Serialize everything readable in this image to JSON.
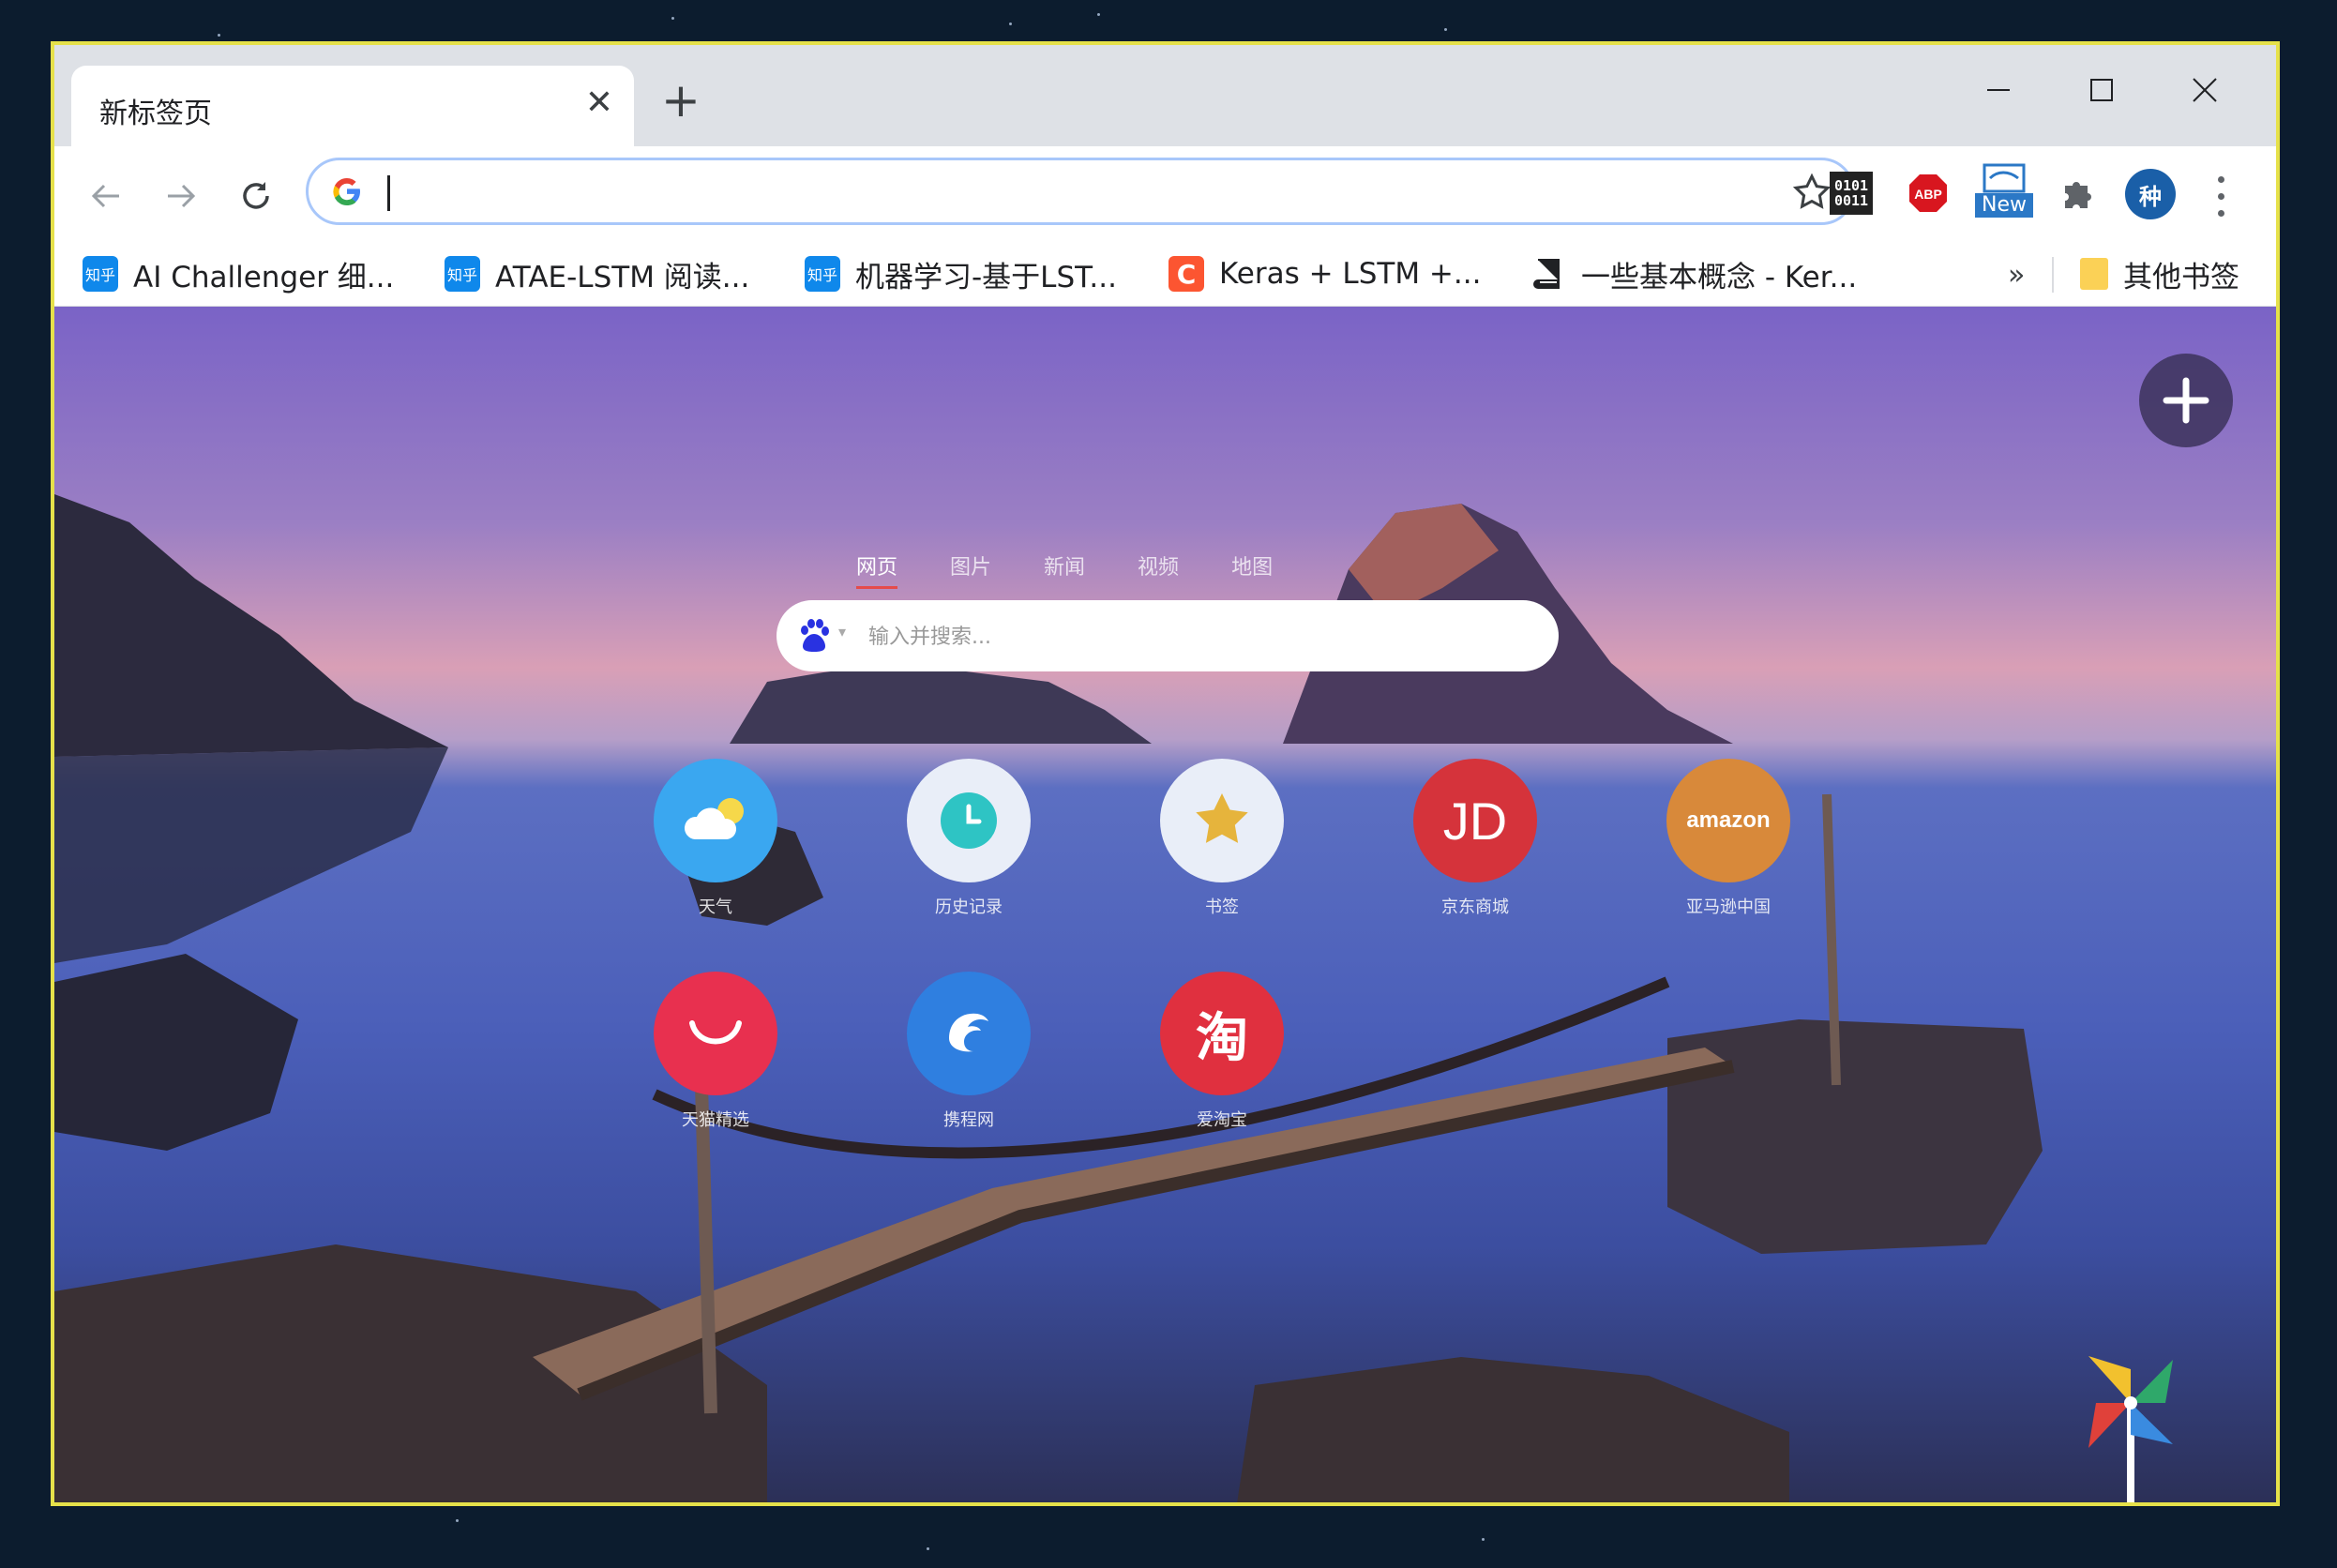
{
  "browser": {
    "tab": {
      "title": "新标签页",
      "close": "✕"
    },
    "new_tab": "+",
    "address": {
      "value": ""
    },
    "extensions": {
      "binary": "0101\n0011",
      "abp": "ABP",
      "new_badge": "New"
    },
    "avatar": "种",
    "colors": {
      "border": "#e6e14a",
      "accent": "#a8c7fa"
    }
  },
  "bookmarks": {
    "items": [
      {
        "label": "AI Challenger 细...",
        "icon": "知乎"
      },
      {
        "label": "ATAE-LSTM 阅读...",
        "icon": "知乎"
      },
      {
        "label": "机器学习-基于LST...",
        "icon": "知乎"
      },
      {
        "label": "Keras + LSTM +...",
        "icon": "C"
      },
      {
        "label": "一些基本概念 - Ker...",
        "icon": "book-icon"
      }
    ],
    "more": "»",
    "other": "其他书签"
  },
  "newtab": {
    "search_tabs": [
      "网页",
      "图片",
      "新闻",
      "视频",
      "地图"
    ],
    "search_placeholder": "输入并搜索...",
    "shortcuts": [
      {
        "label": "天气",
        "color": "#3aa7f0"
      },
      {
        "label": "历史记录",
        "color": "#e9eef8"
      },
      {
        "label": "书签",
        "color": "#e9eef8"
      },
      {
        "label": "京东商城",
        "color": "#d5333b",
        "text": "JD"
      },
      {
        "label": "亚马逊中国",
        "color": "#d8893a",
        "text": "amazon"
      },
      {
        "label": "天猫精选",
        "color": "#e8304f"
      },
      {
        "label": "携程网",
        "color": "#2f7fe0"
      },
      {
        "label": "爱淘宝",
        "color": "#e0303f",
        "text": "淘"
      }
    ]
  }
}
